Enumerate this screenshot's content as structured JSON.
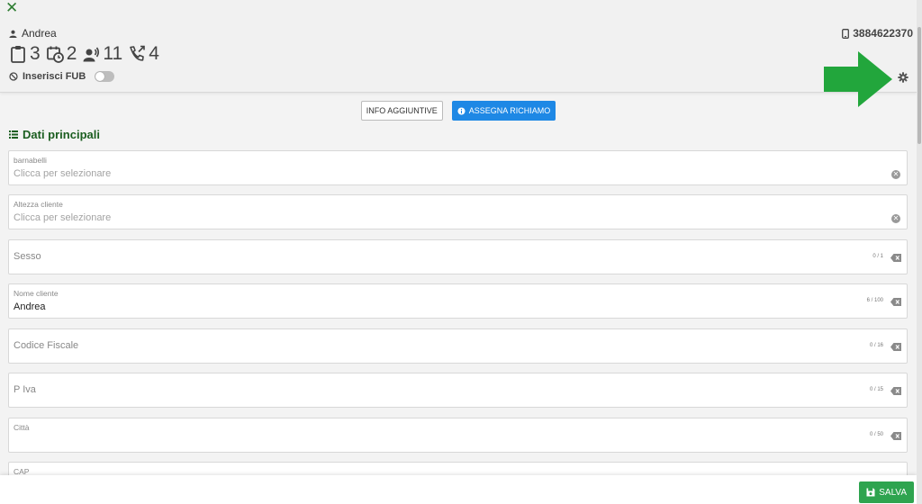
{
  "header": {
    "contact_name": "Andrea",
    "phone": "3884622370",
    "stats": [
      {
        "icon": "clipboard-icon",
        "value": "3"
      },
      {
        "icon": "calendar-clock-icon",
        "value": "2"
      },
      {
        "icon": "speaker-person-icon",
        "value": "11"
      },
      {
        "icon": "phone-calls-icon",
        "value": "4"
      }
    ],
    "fub_label": "Inserisci FUB",
    "fub_toggle_on": false
  },
  "buttons": {
    "info": "INFO AGGIUNTIVE",
    "assegna": "ASSEGNA RICHIAMO",
    "assegna_color": "#1e88e5"
  },
  "section": {
    "title": "Dati principali",
    "title_color": "#1b5e20"
  },
  "fields": [
    {
      "label": "barnabelli",
      "placeholder": "Clicca per selezionare",
      "type": "select"
    },
    {
      "label": "Altezza cliente",
      "placeholder": "Clicca per selezionare",
      "type": "select"
    },
    {
      "label": "Sesso",
      "counter": "0 / 1",
      "type": "text"
    },
    {
      "label": "Nome cliente",
      "value": "Andrea",
      "counter": "6 / 100",
      "type": "text"
    },
    {
      "label": "Codice Fiscale",
      "counter": "0 / 16",
      "type": "text"
    },
    {
      "label": "P Iva",
      "counter": "0 / 15",
      "type": "text"
    },
    {
      "label": "Città",
      "counter": "0 / 50",
      "type": "text"
    },
    {
      "label": "CAP",
      "type": "text"
    }
  ],
  "footer": {
    "save_label": "SALVA",
    "save_color": "#2ea44f"
  },
  "annotation": {
    "arrow_color": "#22a63c"
  }
}
